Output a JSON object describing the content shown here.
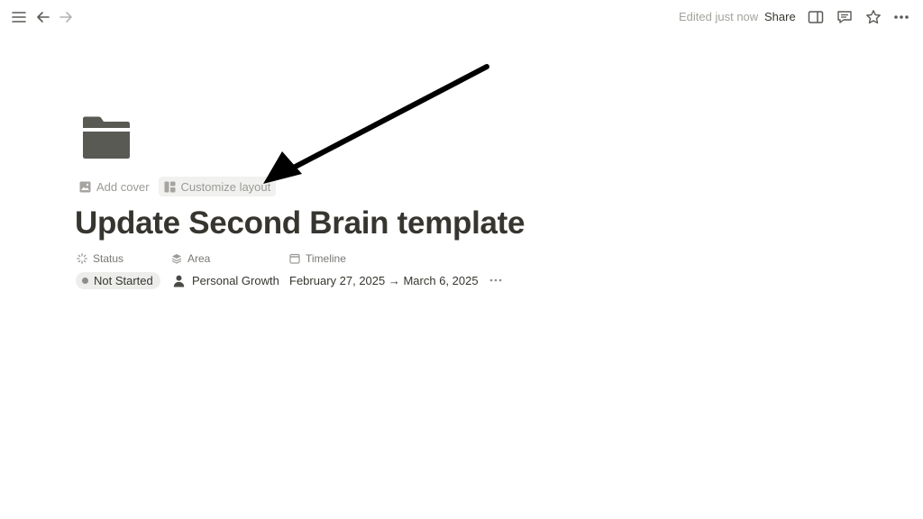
{
  "topbar": {
    "edited_label": "Edited just now",
    "share_label": "Share"
  },
  "page": {
    "icon": "folder-icon",
    "add_cover_label": "Add cover",
    "customize_layout_label": "Customize layout",
    "title": "Update Second Brain template"
  },
  "properties": {
    "status": {
      "label": "Status",
      "value": "Not Started"
    },
    "area": {
      "label": "Area",
      "value": "Personal Growth"
    },
    "timeline": {
      "label": "Timeline",
      "value": "February 27, 2025 → March 6, 2025"
    }
  },
  "colors": {
    "text": "#37352f",
    "muted": "#9b9a97",
    "pill_bg": "#ededeb",
    "folder": "#5a5a55"
  }
}
